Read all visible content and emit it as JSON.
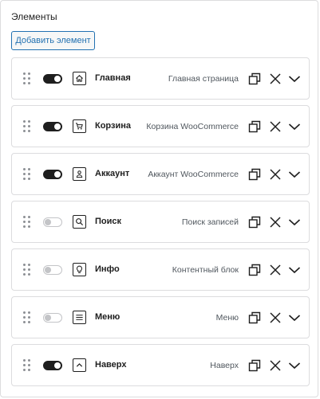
{
  "panel": {
    "title": "Элементы",
    "add_button_label": "Добавить элемент"
  },
  "items": [
    {
      "label": "Главная",
      "description": "Главная страница",
      "enabled": true,
      "icon": "home-icon"
    },
    {
      "label": "Корзина",
      "description": "Корзина WooCommerce",
      "enabled": true,
      "icon": "cart-icon"
    },
    {
      "label": "Аккаунт",
      "description": "Аккаунт WooCommerce",
      "enabled": true,
      "icon": "user-icon"
    },
    {
      "label": "Поиск",
      "description": "Поиск записей",
      "enabled": false,
      "icon": "search-icon"
    },
    {
      "label": "Инфо",
      "description": "Контентный блок",
      "enabled": false,
      "icon": "lightbulb-icon"
    },
    {
      "label": "Меню",
      "description": "Меню",
      "enabled": false,
      "icon": "menu-icon"
    },
    {
      "label": "Наверх",
      "description": "Наверх",
      "enabled": true,
      "icon": "chevron-up-icon"
    }
  ],
  "row_action_icons": [
    "duplicate-icon",
    "close-icon",
    "chevron-down-icon"
  ],
  "colors": {
    "accent": "#2271b1",
    "toggle_on": "#1e1e1e",
    "toggle_off": "#c3c4c7",
    "border": "#dcdcde",
    "muted_text": "#50575e"
  }
}
